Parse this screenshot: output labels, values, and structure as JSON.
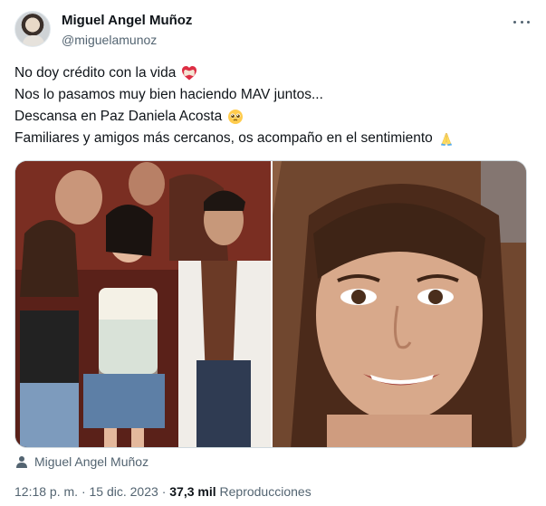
{
  "author": {
    "name": "Miguel Angel Muñoz",
    "handle": "@miguelamunoz"
  },
  "more_menu_icon": "more-horizontal-icon",
  "tweet": {
    "lines": [
      {
        "text": "No doy crédito con la vida",
        "emoji": "heart-bandage-icon"
      },
      {
        "text": "Nos lo pasamos muy bien haciendo MAV juntos...",
        "emoji": ""
      },
      {
        "text": "Descansa en Paz Daniela Acosta",
        "emoji": "pleading-face-icon"
      },
      {
        "text": "Familiares y amigos más cercanos, os acompaño en el sentimiento",
        "emoji": "folded-hands-icon"
      }
    ]
  },
  "media": {
    "images": [
      "group-photo",
      "portrait-photo"
    ],
    "tagged_user": "Miguel Angel Muñoz"
  },
  "meta": {
    "time": "12:18 p. m.",
    "separator": "·",
    "date": "15 dic. 2023",
    "views_count": "37,3 mil",
    "views_label": "Reproducciones"
  },
  "colors": {
    "text_primary": "#0f1419",
    "text_secondary": "#536471",
    "border": "#cfd9de",
    "heart_red": "#e0245e"
  }
}
